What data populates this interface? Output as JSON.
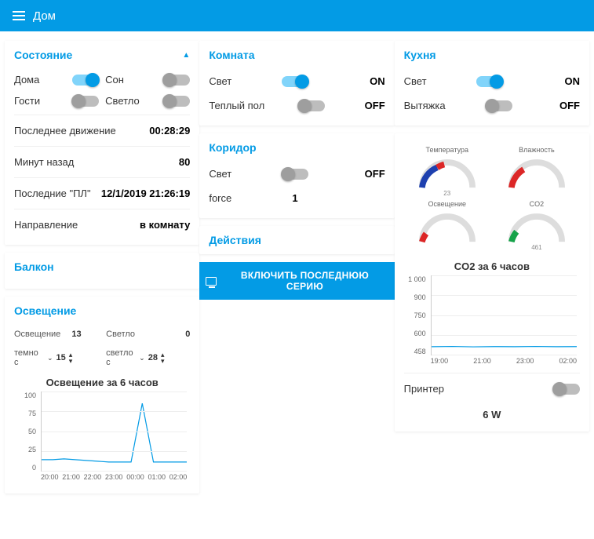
{
  "header": {
    "title": "Дом"
  },
  "col1": {
    "state": {
      "title": "Состояние",
      "home": {
        "label": "Дома",
        "on": true
      },
      "sleep": {
        "label": "Сон",
        "on": false
      },
      "guests": {
        "label": "Гости",
        "on": false
      },
      "light": {
        "label": "Светло",
        "on": false
      },
      "last_motion": {
        "label": "Последнее движение",
        "value": "00:28:29"
      },
      "minutes_ago": {
        "label": "Минут назад",
        "value": "80"
      },
      "last_pl": {
        "label": "Последние \"ПЛ\"",
        "value": "12/1/2019 21:26:19"
      },
      "direction": {
        "label": "Направление",
        "value": "в комнату"
      }
    },
    "balcony": {
      "title": "Балкон"
    },
    "lighting": {
      "title": "Освещение",
      "lux": {
        "label": "Освещение",
        "value": "13"
      },
      "bright": {
        "label": "Светло",
        "value": "0"
      },
      "dark_from": {
        "label": "темно с",
        "value": "15"
      },
      "bright_from": {
        "label": "светло с",
        "value": "28"
      }
    }
  },
  "col2": {
    "room": {
      "title": "Комната",
      "light": {
        "label": "Свет",
        "on": true,
        "state": "ON"
      },
      "floor": {
        "label": "Теплый пол",
        "on": false,
        "state": "OFF"
      }
    },
    "corridor": {
      "title": "Коридор",
      "light": {
        "label": "Свет",
        "on": false,
        "state": "OFF"
      },
      "force": {
        "label": "force",
        "value": "1"
      }
    },
    "actions": {
      "title": "Действия",
      "button": "ВКЛЮЧИТЬ ПОСЛЕДНЮЮ СЕРИЮ"
    }
  },
  "col3": {
    "kitchen": {
      "title": "Кухня",
      "light": {
        "label": "Свет",
        "on": true,
        "state": "ON"
      },
      "hood": {
        "label": "Вытяжка",
        "on": false,
        "state": "OFF"
      }
    },
    "gauges": {
      "temp": {
        "label": "Температура",
        "value": "23"
      },
      "humidity": {
        "label": "Влажность",
        "value": ""
      },
      "lux": {
        "label": "Освещение",
        "value": ""
      },
      "co2": {
        "label": "CO2",
        "value": "461"
      }
    },
    "printer": {
      "label": "Принтер",
      "on": false
    },
    "power": "6 W"
  },
  "chart_data": [
    {
      "type": "line",
      "title": "Освещение за 6 часов",
      "ylabel": "",
      "xlabel": "",
      "ylim": [
        0,
        100
      ],
      "y_ticks": [
        0,
        25,
        50,
        75,
        100
      ],
      "x_ticks": [
        "20:00",
        "21:00",
        "22:00",
        "23:00",
        "00:00",
        "01:00",
        "02:00"
      ],
      "x": [
        "20:00",
        "20:30",
        "21:00",
        "21:30",
        "22:00",
        "22:30",
        "23:00",
        "23:30",
        "00:00",
        "00:15",
        "00:30",
        "01:00",
        "01:30",
        "02:00"
      ],
      "values": [
        14,
        14,
        15,
        14,
        13,
        12,
        11,
        11,
        11,
        85,
        11,
        11,
        11,
        11
      ]
    },
    {
      "type": "line",
      "title": "CO2 за 6 часов",
      "ylabel": "",
      "xlabel": "",
      "ylim": [
        400,
        1000
      ],
      "y_ticks": [
        458,
        600,
        750,
        900,
        1000
      ],
      "y_tick_labels": [
        "458",
        "600",
        "750",
        "900",
        "1 000"
      ],
      "x_ticks": [
        "19:00",
        "21:00",
        "23:00",
        "02:00"
      ],
      "x": [
        "19:00",
        "20:00",
        "21:00",
        "22:00",
        "23:00",
        "00:00",
        "01:00",
        "02:00"
      ],
      "values": [
        460,
        462,
        459,
        461,
        460,
        462,
        460,
        461
      ]
    }
  ]
}
